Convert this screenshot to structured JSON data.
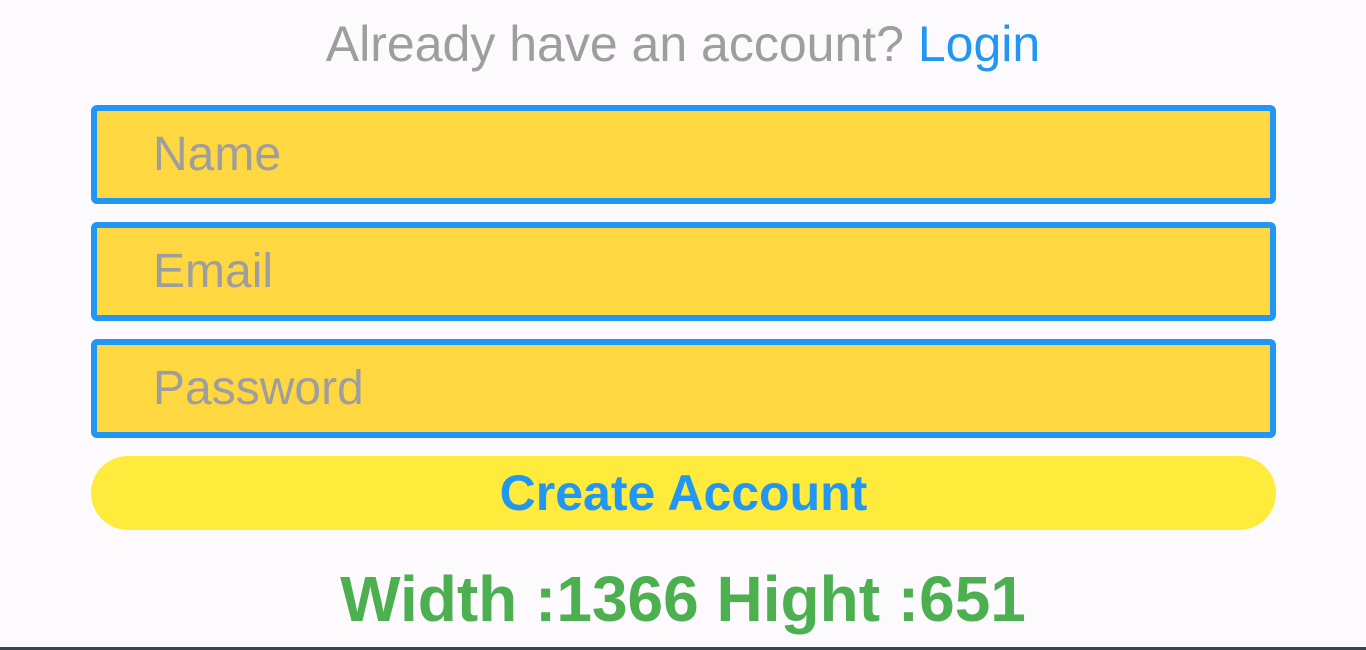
{
  "header": {
    "prompt_text": "Already have an account? ",
    "login_link": "Login"
  },
  "form": {
    "name_placeholder": "Name",
    "email_placeholder": "Email",
    "password_placeholder": "Password",
    "submit_label": "Create Account"
  },
  "footer": {
    "dimensions_text": "Width :1366 Hight :651"
  },
  "colors": {
    "background": "#fdfafd",
    "field_fill": "#ffd740",
    "field_border": "#2196f3",
    "button_fill": "#ffeb3b",
    "button_text": "#2196f3",
    "prompt_text": "#9e9e9e",
    "link_text": "#2196f3",
    "dimensions_text": "#4caf50"
  }
}
